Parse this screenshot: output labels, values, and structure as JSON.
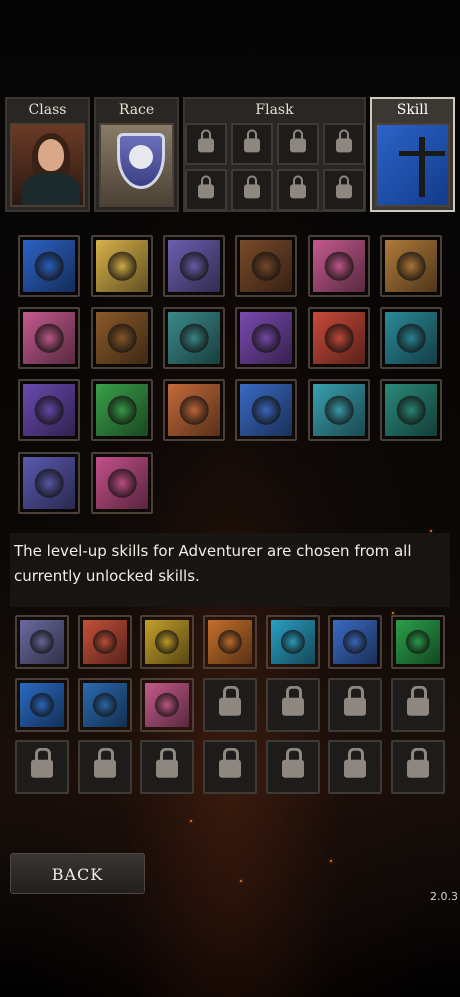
{
  "tabs": {
    "class": {
      "label": "Class",
      "icon": "adventurer-portrait-icon"
    },
    "race": {
      "label": "Race",
      "icon": "race-crest-icon"
    },
    "flask": {
      "label": "Flask",
      "icon": "padlock-icon"
    },
    "skill": {
      "label": "Skill",
      "icon": "skill-figure-icon",
      "selected": true
    }
  },
  "skill_pool": [
    {
      "name": "puppet-skill-icon",
      "color": "#2c63c6"
    },
    {
      "name": "beetle-shell-icon",
      "color": "#d8b24a"
    },
    {
      "name": "bandaged-skull-icon",
      "color": "#6c5fb0"
    },
    {
      "name": "chained-door-icon",
      "color": "#7a4a2a"
    },
    {
      "name": "hooded-summoner-icon",
      "color": "#c45a8e"
    },
    {
      "name": "skeleton-warrior-icon",
      "color": "#b07a3a"
    },
    {
      "name": "hand-coin-icon",
      "color": "#c45a8e"
    },
    {
      "name": "coin-pile-icon",
      "color": "#8a5a2a"
    },
    {
      "name": "woman-portrait-icon",
      "color": "#3a8a8a"
    },
    {
      "name": "dark-wanderer-icon",
      "color": "#7a4ab0"
    },
    {
      "name": "fireball-icon",
      "color": "#c84a3a"
    },
    {
      "name": "spellbook-icon",
      "color": "#2a8a9a"
    },
    {
      "name": "reaching-hand-icon",
      "color": "#6a4ab0"
    },
    {
      "name": "round-shield-icon",
      "color": "#3aa04a"
    },
    {
      "name": "battle-axe-icon",
      "color": "#c46a3a"
    },
    {
      "name": "scattered-coins-icon",
      "color": "#3a6ac4"
    },
    {
      "name": "serpent-dagger-icon",
      "color": "#3aa0b0"
    },
    {
      "name": "grasping-hand-icon",
      "color": "#2a8a7a"
    },
    {
      "name": "potion-hand-icon",
      "color": "#5a5ab0"
    },
    {
      "name": "golden-staff-icon",
      "color": "#c4508a"
    }
  ],
  "description": {
    "line1": "The level-up skills for Adventurer are chosen from all",
    "line2": "currently unlocked skills."
  },
  "unlocked_skills": [
    {
      "name": "crossed-swords-icon",
      "color": "#6a6aa0"
    },
    {
      "name": "book-flame-icon",
      "color": "#c4503a"
    },
    {
      "name": "knight-shield-icon",
      "color": "#c4a02a"
    },
    {
      "name": "bomb-icon",
      "color": "#c4702a"
    },
    {
      "name": "skeleton-icon",
      "color": "#2aa0c4"
    },
    {
      "name": "blue-potion-icon",
      "color": "#3a6ac4"
    },
    {
      "name": "meditating-figure-icon",
      "color": "#2aa04a"
    },
    {
      "name": "blue-dagger-icon",
      "color": "#2a6ac4"
    },
    {
      "name": "iron-shield-icon",
      "color": "#2a6ab0"
    },
    {
      "name": "potion-bag-icon",
      "color": "#c45a8a"
    }
  ],
  "locked_slot_count": 11,
  "buttons": {
    "back": "BACK"
  },
  "version": "2.0.3"
}
